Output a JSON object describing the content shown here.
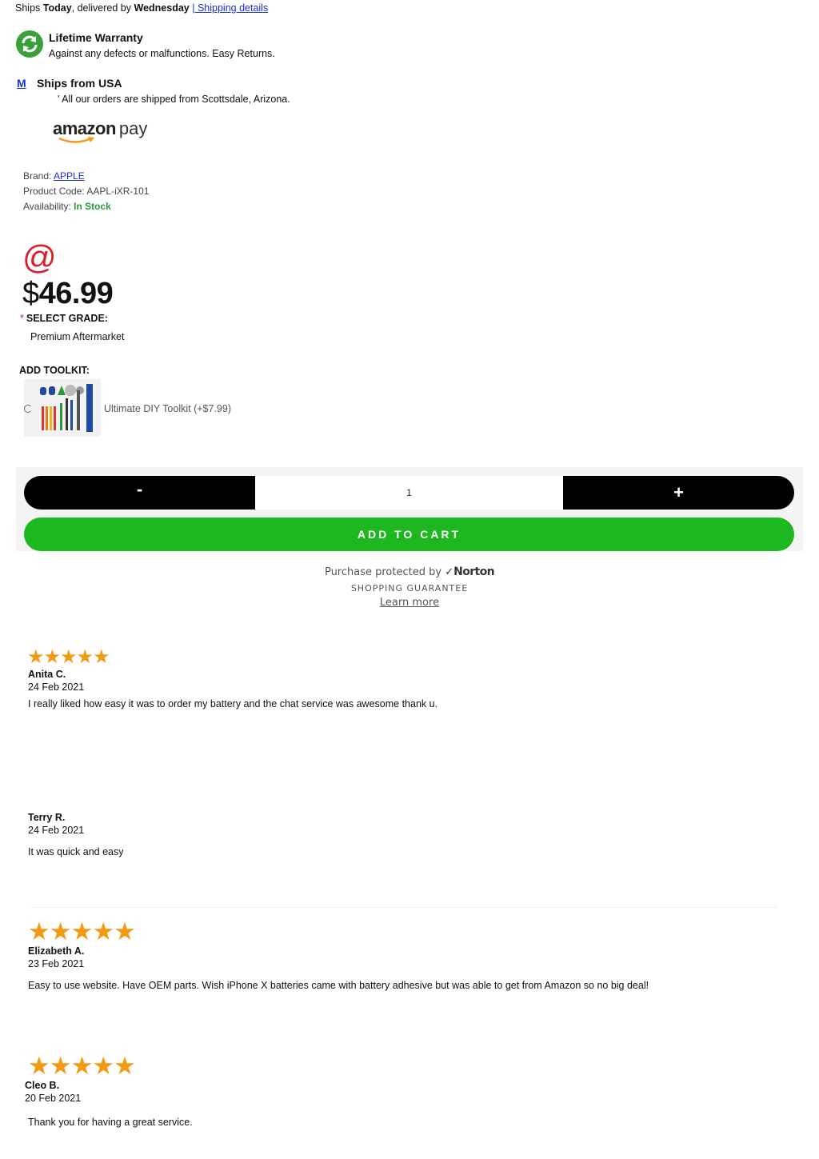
{
  "shipping": {
    "prefix": "Ships",
    "today": "Today",
    "middle": ", delivered by",
    "day": "Wednesday",
    "sep": "|",
    "link": " Shipping details"
  },
  "warranty": {
    "title": "Lifetime Warranty",
    "desc": "Against any defects or malfunctions. Easy Returns."
  },
  "usa": {
    "mark": "M",
    "title": "Ships from USA",
    "desc": "' All our orders are shipped from Scottsdale, Arizona."
  },
  "amazon_pay": {
    "brand": "amazon",
    "suffix": "pay"
  },
  "product": {
    "brand_label": "Brand:",
    "brand_value": "APPLE",
    "code_label": "Product Code:",
    "code_value": "AAPL-iXR-101",
    "avail_label": "Availability:",
    "avail_value": "In Stock"
  },
  "price": {
    "at": "@",
    "currency": "$",
    "amount": "46.99"
  },
  "grade": {
    "required_mark": "*",
    "label": "SELECT GRADE:",
    "value": "Premium Aftermarket"
  },
  "toolkit": {
    "label": "ADD TOOLKIT:",
    "option": "Ultimate DIY Toolkit (+$7.99)",
    "image_alt": "toolkit-image"
  },
  "cart": {
    "minus": "-",
    "quantity": "1",
    "plus": "+",
    "add_label": "ADD TO CART"
  },
  "norton": {
    "protected": "Purchase protected by",
    "brand": "Norton",
    "guarantee": "SHOPPING GUARANTEE",
    "learn_more": "Learn more"
  },
  "reviews": [
    {
      "stars": 5,
      "name": "Anita C.",
      "date": "24 Feb 2021",
      "text": "I really liked how easy it was to order my battery and the chat service was awesome thank u."
    },
    {
      "stars": 0,
      "name": "Terry R.",
      "date": "24 Feb 2021",
      "text": "It was quick and easy"
    },
    {
      "stars": 5,
      "name": "Elizabeth A.",
      "date": "23 Feb 2021",
      "text": "Easy to use website. Have OEM parts. Wish iPhone X batteries came with battery adhesive but was able to get from Amazon so no big deal!"
    },
    {
      "stars": 5,
      "name": "Cleo B.",
      "date": "20 Feb 2021",
      "text": "Thank you for having a great service."
    }
  ],
  "colors": {
    "accent_green": "#1db71f",
    "stock_green": "#2a9a3a",
    "star_orange": "#f39a14",
    "required_red": "#d6202a",
    "link_blue": "#1a2fcf"
  }
}
